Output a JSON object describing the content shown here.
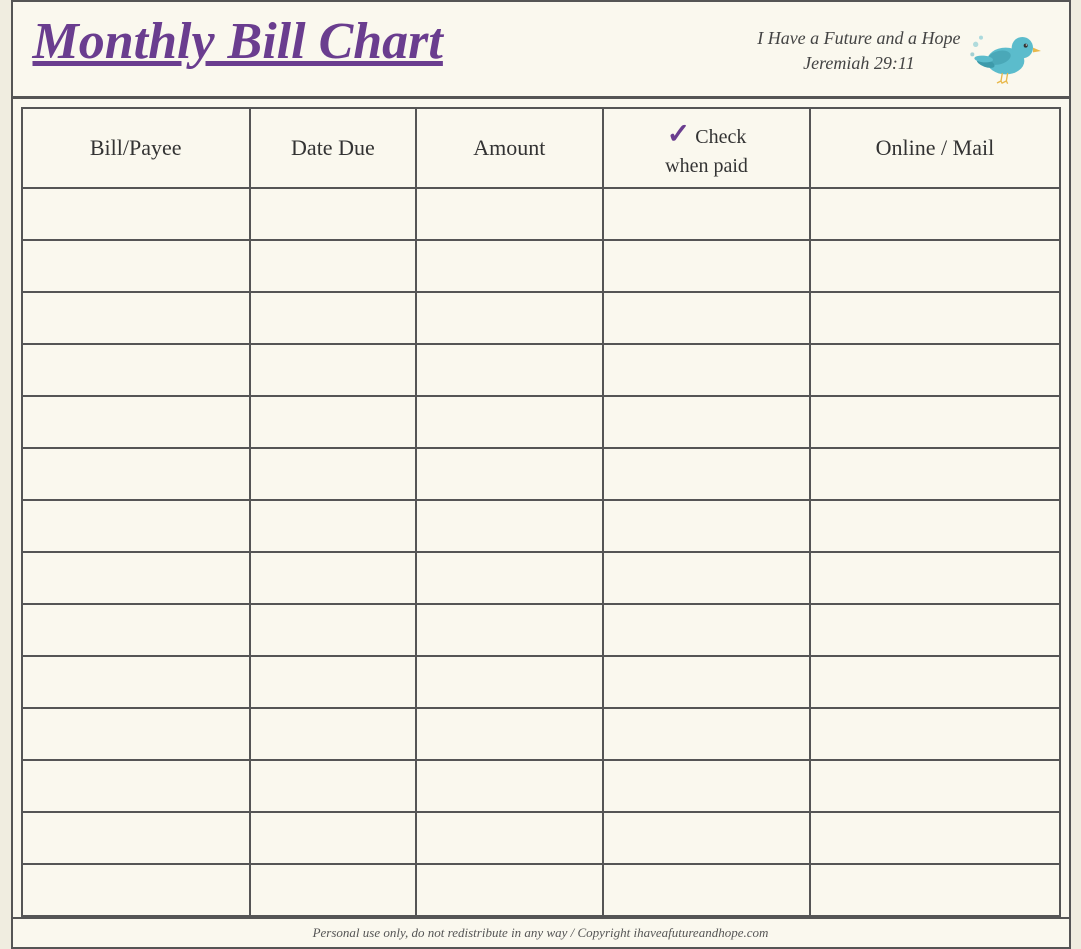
{
  "header": {
    "title": "Monthly Bill Chart",
    "tagline_line1": "I Have a Future and a Hope",
    "tagline_line2": "Jeremiah 29:11"
  },
  "table": {
    "columns": [
      {
        "id": "bill-payee",
        "label": "Bill/Payee"
      },
      {
        "id": "date-due",
        "label": "Date Due"
      },
      {
        "id": "amount",
        "label": "Amount"
      },
      {
        "id": "check-when-paid",
        "label": "Check\nwhen paid",
        "has_checkmark": true
      },
      {
        "id": "online-mail",
        "label": "Online / Mail"
      }
    ],
    "row_count": 14
  },
  "footer": {
    "text": "Personal use only, do not redistribute in any way / Copyright ihaveafutureandhope.com"
  },
  "colors": {
    "title": "#6a3d8f",
    "border": "#555555",
    "check": "#6a3d8f",
    "background": "#faf8ee",
    "text": "#333333"
  }
}
